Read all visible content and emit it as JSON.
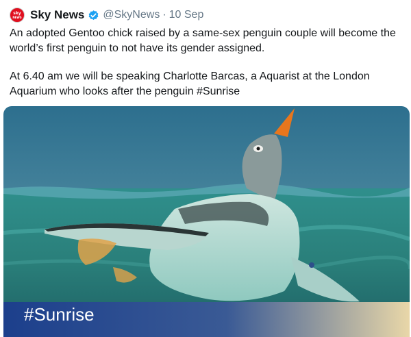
{
  "tweet": {
    "author_name": "Sky News",
    "avatar_text": [
      "sky",
      "NEWS"
    ],
    "handle": "@SkyNews",
    "separator": "·",
    "date": "10 Sep",
    "paragraphs": [
      "An adopted Gentoo chick raised by a same-sex penguin couple will become the world’s first penguin to not have its gender assigned.",
      "At 6.40 am we will be speaking Charlotte Barcas, a Aquarist at the London Aquarium who looks after the penguin #Sunrise"
    ]
  },
  "media": {
    "caption": "#Sunrise",
    "icon": "penguin-photo"
  },
  "colors": {
    "avatar": "#e10e1e",
    "verified": "#1da1f2",
    "secondary_text": "#657786",
    "caption_band": "#1c3f8c"
  }
}
